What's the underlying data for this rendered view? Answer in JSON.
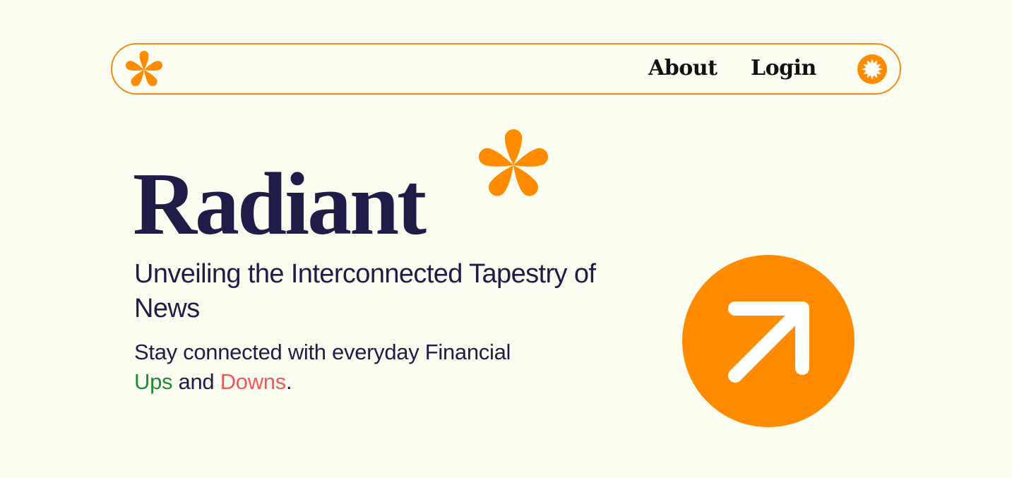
{
  "nav": {
    "about_label": "About",
    "login_label": "Login",
    "logo_icon": "asterisk-logo-icon",
    "badge_icon": "sunburst-icon"
  },
  "hero": {
    "brand": "Radiant",
    "brand_icon": "asterisk-icon",
    "headline": "Unveiling the Interconnected Tapestry of News",
    "subtext_prefix": "Stay connected with everyday Financial",
    "ups": "Ups",
    "and": " and ",
    "downs": "Downs",
    "period": "."
  },
  "cta": {
    "icon": "arrow-up-right-icon"
  },
  "colors": {
    "background": "#fcfdf1",
    "accent": "#ff8c00",
    "navy": "#1f1d47",
    "ups": "#1e8b35",
    "downs": "#ee5a58"
  }
}
